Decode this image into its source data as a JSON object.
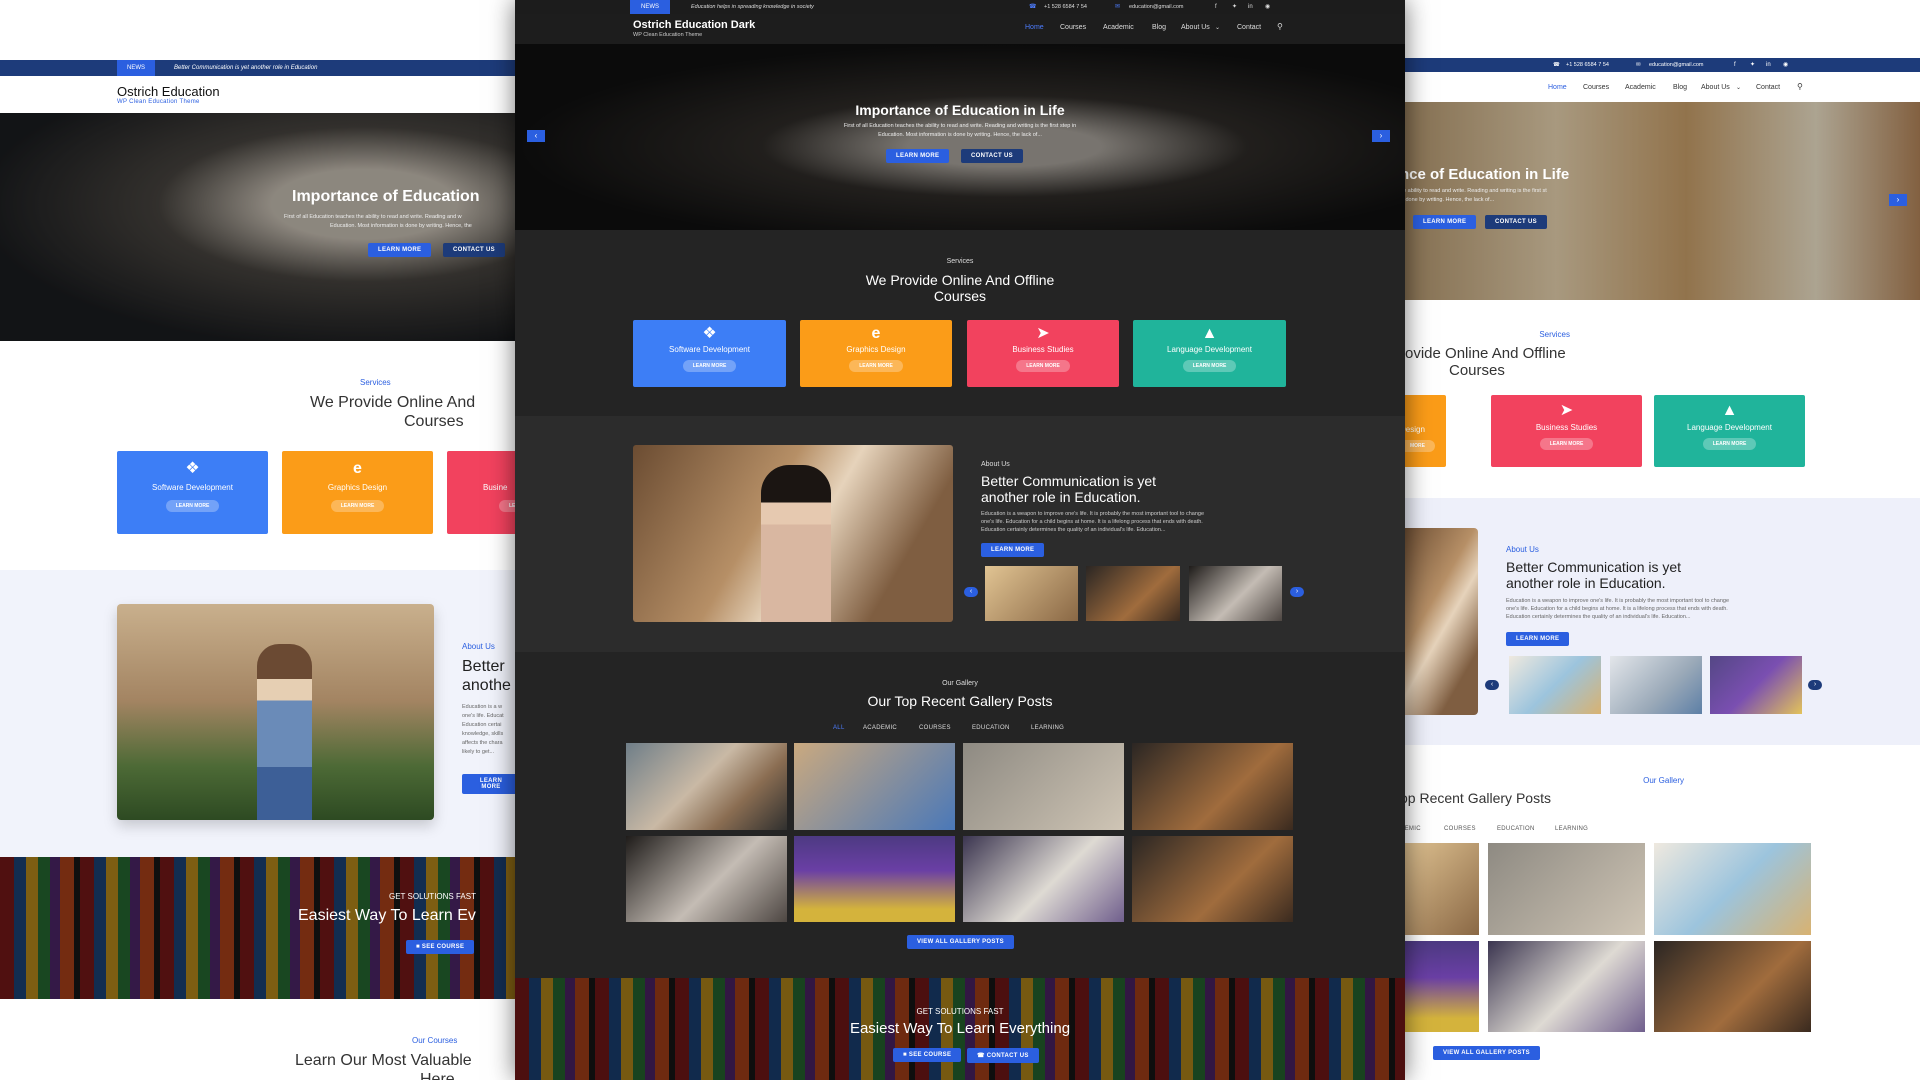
{
  "left": {
    "news_tag": "NEWS",
    "news_text": "Better Communication is yet another role in Education",
    "brand": "Ostrich Education",
    "brand_sub": "WP Clean Education Theme",
    "hero_title": "Importance of Education",
    "hero_text_1": "First of all Education teaches the ability to read and write. Reading and w",
    "hero_text_2": "Education. Most information is done by writing. Hence, the",
    "btn_learn": "LEARN MORE",
    "btn_contact": "CONTACT US",
    "services_kicker": "Services",
    "services_title_1": "We Provide Online And",
    "services_title_2": "Courses",
    "cards": [
      {
        "label": "Software Development",
        "btn": "LEARN MORE"
      },
      {
        "label": "Graphics Design",
        "btn": "LEARN MORE"
      },
      {
        "label": "Busine",
        "btn": "LE"
      }
    ],
    "about_kicker": "About Us",
    "about_title_1": "Better",
    "about_title_2": "anothe",
    "about_lines": [
      "Education is a w",
      "one's life. Educat",
      "Education certai",
      "knowledge, skills",
      "affects the chara",
      "likely to get..."
    ],
    "about_btn": "LEARN MORE",
    "cta_kicker": "GET SOLUTIONS FAST",
    "cta_title": "Easiest Way To Learn Ev",
    "cta_btn": "SEE COURSE",
    "courses_kicker": "Our Courses",
    "courses_title_1": "Learn Our Most Valuable",
    "courses_title_2": "Here"
  },
  "center": {
    "news_tag": "NEWS",
    "news_text": "Education helps in spreading knowledge in society",
    "phone": "+1 528 6584 7 54",
    "email": "education@gmail.com",
    "brand": "Ostrich Education Dark",
    "brand_sub": "WP Clean Education Theme",
    "nav": [
      "Home",
      "Courses",
      "Academic",
      "Blog",
      "About Us",
      "Contact"
    ],
    "hero_title": "Importance of Education in Life",
    "hero_text_1": "First of all Education teaches the ability to read and write. Reading and writing is the first step in",
    "hero_text_2": "Education. Most information is done by writing. Hence, the lack of...",
    "btn_learn": "LEARN MORE",
    "btn_contact": "CONTACT US",
    "services_kicker": "Services",
    "services_title_1": "We Provide Online And Offline",
    "services_title_2": "Courses",
    "cards": [
      {
        "label": "Software Development",
        "btn": "LEARN MORE"
      },
      {
        "label": "Graphics Design",
        "btn": "LEARN MORE"
      },
      {
        "label": "Business Studies",
        "btn": "LEARN MORE"
      },
      {
        "label": "Language Development",
        "btn": "LEARN MORE"
      }
    ],
    "about_kicker": "About Us",
    "about_title_1": "Better Communication is yet",
    "about_title_2": "another role in Education.",
    "about_lines": [
      "Education is a weapon to improve one's life. It is probably the most important tool to change",
      "one's life. Education for a child begins at home. It is a lifelong process that ends with death.",
      "Education certainly determines the quality of an individual's life. Education..."
    ],
    "about_btn": "LEARN MORE",
    "gallery_kicker": "Our Gallery",
    "gallery_title": "Our Top Recent Gallery Posts",
    "gallery_tabs": [
      "ALL",
      "ACADEMIC",
      "COURSES",
      "EDUCATION",
      "LEARNING"
    ],
    "gallery_btn": "VIEW ALL GALLERY POSTS",
    "cta_kicker": "GET SOLUTIONS FAST",
    "cta_title": "Easiest Way To Learn Everything",
    "cta_btn_1": "SEE COURSE",
    "cta_btn_2": "CONTACT US"
  },
  "right": {
    "phone": "+1 528 6584 7 54",
    "email": "education@gmail.com",
    "nav": [
      "Home",
      "Courses",
      "Academic",
      "Blog",
      "About Us",
      "Contact"
    ],
    "hero_title": "nce of Education in Life",
    "hero_text_1": "he ability to read and write. Reading and writing is the first st",
    "hero_text_2": "is done by writing. Hence, the lack of...",
    "btn_learn": "LEARN MORE",
    "btn_contact": "CONTACT US",
    "services_kicker": "Services",
    "services_title_1": "rovide Online And Offline",
    "services_title_2": "Courses",
    "cards": [
      {
        "label": "Design",
        "btn": "MORE"
      },
      {
        "label": "Business Studies",
        "btn": "LEARN MORE"
      },
      {
        "label": "Language Development",
        "btn": "LEARN MORE"
      }
    ],
    "about_kicker": "About Us",
    "about_title_1": "Better Communication is yet",
    "about_title_2": "another role in Education.",
    "about_lines": [
      "Education is a weapon to improve one's life. It is probably the most important tool to change",
      "one's life. Education for a child begins at home. It is a lifelong process that ends with death.",
      "Education certainly determines the quality of an individual's life. Education..."
    ],
    "about_btn": "LEARN MORE",
    "gallery_kicker": "Our Gallery",
    "gallery_title": "op Recent Gallery Posts",
    "gallery_tabs": [
      "DEMIC",
      "COURSES",
      "EDUCATION",
      "LEARNING"
    ],
    "gallery_btn": "VIEW ALL GALLERY POSTS"
  },
  "colors": {
    "accent": "#2b5fe0",
    "navy": "#1d3b7a",
    "card_blue": "#3d7ef6",
    "card_orange": "#fb9c18",
    "card_red": "#f2425e",
    "card_teal": "#20b49b",
    "dark_bg": "#242424"
  },
  "icons": [
    "phone-icon",
    "email-icon",
    "facebook-icon",
    "twitter-icon",
    "linkedin-icon",
    "instagram-icon",
    "search-icon",
    "chevron-left-icon",
    "chevron-right-icon",
    "code-icon",
    "edge-icon",
    "rocket-icon",
    "language-icon"
  ]
}
